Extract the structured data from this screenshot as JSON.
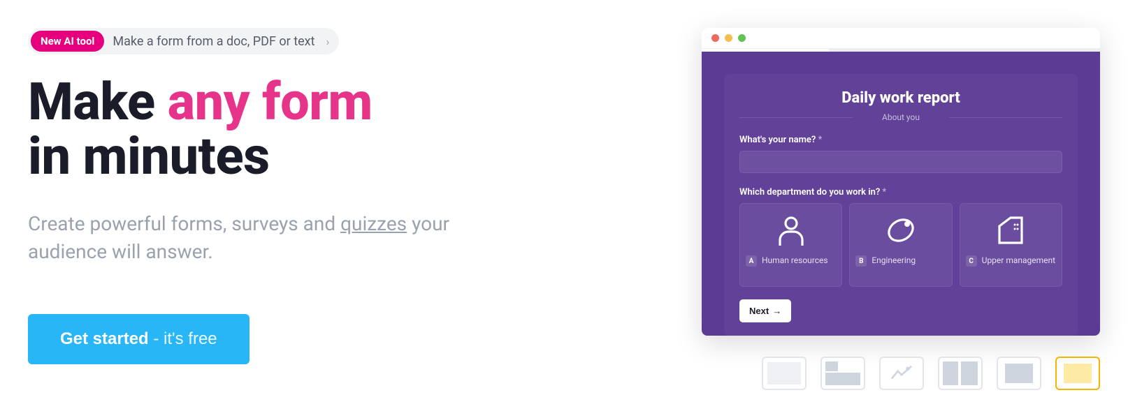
{
  "promo": {
    "badge": "New AI tool",
    "text": "Make a form from a doc, PDF or text"
  },
  "headline": {
    "part1": "Make ",
    "highlight": "any form",
    "part2": "in minutes"
  },
  "sub": {
    "before": "Create powerful forms, surveys and ",
    "link": "quizzes",
    "after": " your audience will answer."
  },
  "cta": {
    "bold": "Get started",
    "light": " - it's free"
  },
  "preview": {
    "title": "Daily work report",
    "section": "About you",
    "q1_label": "What's your name?",
    "q1_required": "*",
    "q2_label": "Which department do you work in?",
    "q2_required": "*",
    "options": [
      {
        "key": "A",
        "label": "Human resources"
      },
      {
        "key": "B",
        "label": "Engineering"
      },
      {
        "key": "C",
        "label": "Upper management"
      }
    ],
    "next": "Next"
  }
}
